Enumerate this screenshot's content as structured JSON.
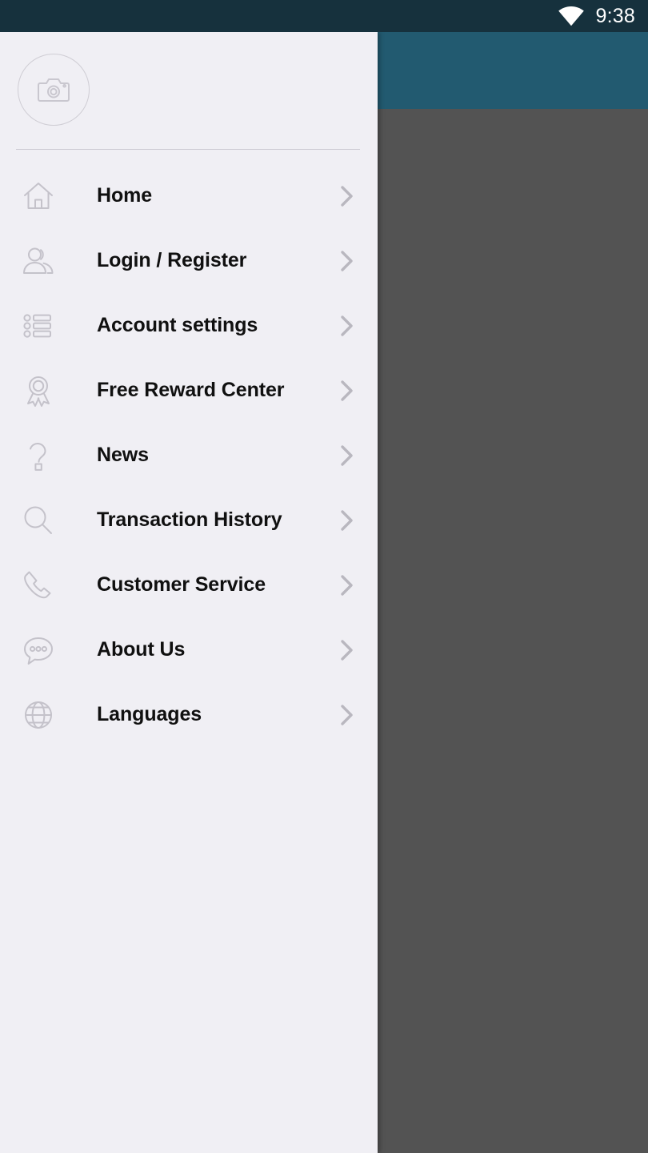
{
  "status_bar": {
    "time": "9:38",
    "wifi_icon": "wifi-icon",
    "background_color": "#16313d",
    "text_color": "#ffffff"
  },
  "app_background": {
    "app_bar_color": "#225a70",
    "scrim_color": "#535353"
  },
  "drawer": {
    "background_color": "#f0eff4",
    "header": {
      "avatar_icon": "camera-icon",
      "avatar_placeholder": true
    },
    "items": [
      {
        "label": "Home",
        "icon": "home-icon"
      },
      {
        "label": "Login / Register",
        "icon": "users-icon"
      },
      {
        "label": "Account settings",
        "icon": "list-settings-icon"
      },
      {
        "label": "Free Reward Center",
        "icon": "award-ribbon-icon"
      },
      {
        "label": "News",
        "icon": "question-mark-icon"
      },
      {
        "label": "Transaction History",
        "icon": "magnifier-icon"
      },
      {
        "label": "Customer Service",
        "icon": "phone-icon"
      },
      {
        "label": "About Us",
        "icon": "chat-bubble-icon"
      },
      {
        "label": "Languages",
        "icon": "globe-icon"
      }
    ],
    "chevron_icon": "chevron-right-icon",
    "label_color": "#101010",
    "icon_color": "#c4c2ca",
    "chevron_color": "#b9b7bf"
  }
}
